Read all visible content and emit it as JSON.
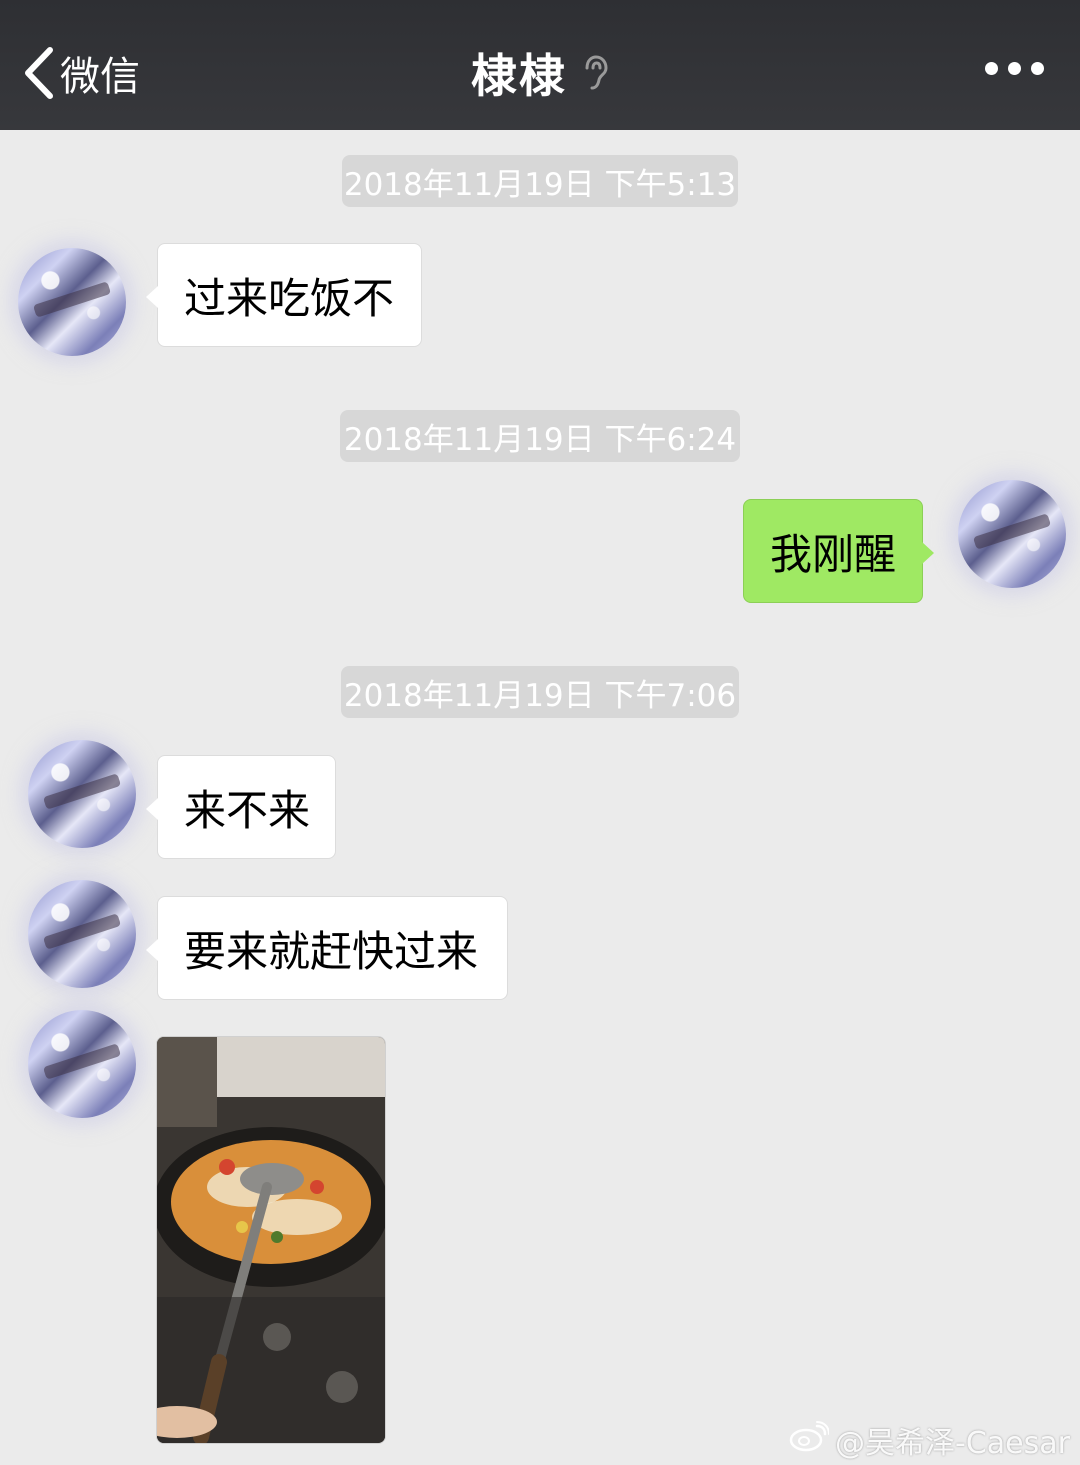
{
  "header": {
    "back_label": "微信",
    "title": "棣棣",
    "icons": [
      "back-chevron-icon",
      "ear-icon",
      "more-icon"
    ]
  },
  "timestamps": [
    "2018年11月19日 下午5:13",
    "2018年11月19日 下午6:24",
    "2018年11月19日 下午7:06"
  ],
  "messages": [
    {
      "side": "left",
      "text": "过来吃饭不"
    },
    {
      "side": "right",
      "text": "我刚醒"
    },
    {
      "side": "left",
      "text": "来不来"
    },
    {
      "side": "left",
      "text": "要来就赶快过来"
    },
    {
      "side": "left",
      "type": "image",
      "content": "photo of soup cooking in a wok"
    }
  ],
  "watermark": "@吴希泽-Caesar",
  "colors": {
    "topbar": "#35363a",
    "background": "#ebebeb",
    "sent_bubble": "#9fe963",
    "received_bubble": "#ffffff",
    "timestamp_pill": "#d7d7d7"
  }
}
